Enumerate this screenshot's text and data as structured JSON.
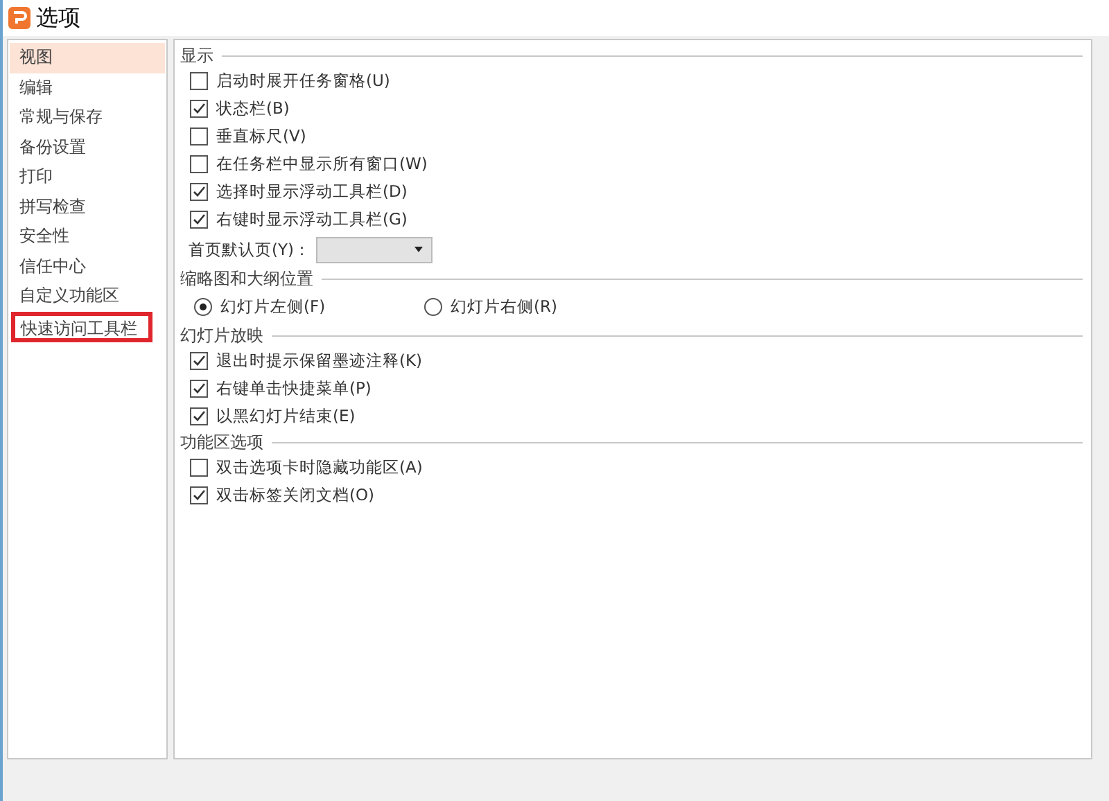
{
  "window": {
    "title": "选项"
  },
  "sidebar": {
    "items": [
      {
        "label": "视图",
        "selected": true,
        "highlighted": false
      },
      {
        "label": "编辑",
        "selected": false,
        "highlighted": false
      },
      {
        "label": "常规与保存",
        "selected": false,
        "highlighted": false
      },
      {
        "label": "备份设置",
        "selected": false,
        "highlighted": false
      },
      {
        "label": "打印",
        "selected": false,
        "highlighted": false
      },
      {
        "label": "拼写检查",
        "selected": false,
        "highlighted": false
      },
      {
        "label": "安全性",
        "selected": false,
        "highlighted": false
      },
      {
        "label": "信任中心",
        "selected": false,
        "highlighted": false
      },
      {
        "label": "自定义功能区",
        "selected": false,
        "highlighted": false
      },
      {
        "label": "快速访问工具栏",
        "selected": false,
        "highlighted": true
      }
    ]
  },
  "sections": [
    {
      "title": "显示",
      "items": [
        {
          "kind": "checkbox",
          "label": "启动时展开任务窗格(U)",
          "checked": false
        },
        {
          "kind": "checkbox",
          "label": "状态栏(B)",
          "checked": true
        },
        {
          "kind": "checkbox",
          "label": "垂直标尺(V)",
          "checked": false
        },
        {
          "kind": "checkbox",
          "label": "在任务栏中显示所有窗口(W)",
          "checked": false
        },
        {
          "kind": "checkbox",
          "label": "选择时显示浮动工具栏(D)",
          "checked": true
        },
        {
          "kind": "checkbox",
          "label": "右键时显示浮动工具栏(G)",
          "checked": true
        },
        {
          "kind": "dropdown",
          "label": "首页默认页(Y)："
        }
      ]
    },
    {
      "title": "缩略图和大纲位置",
      "items": [
        {
          "kind": "radio-group",
          "options": [
            {
              "label": "幻灯片左侧(F)",
              "selected": true
            },
            {
              "label": "幻灯片右侧(R)",
              "selected": false
            }
          ]
        }
      ]
    },
    {
      "title": "幻灯片放映",
      "items": [
        {
          "kind": "checkbox",
          "label": "退出时提示保留墨迹注释(K)",
          "checked": true
        },
        {
          "kind": "checkbox",
          "label": "右键单击快捷菜单(P)",
          "checked": true
        },
        {
          "kind": "checkbox",
          "label": "以黑幻灯片结束(E)",
          "checked": true
        }
      ]
    },
    {
      "title": "功能区选项",
      "items": [
        {
          "kind": "checkbox",
          "label": "双击选项卡时隐藏功能区(A)",
          "checked": false
        },
        {
          "kind": "checkbox",
          "label": "双击标签关闭文档(O)",
          "checked": true
        }
      ]
    }
  ]
}
